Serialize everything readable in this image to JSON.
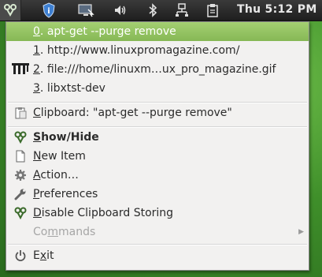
{
  "panel": {
    "clock": "Thu  5:12 PM",
    "icons": [
      "parcellite-icon",
      "security-shield-icon",
      "display-icon",
      "volume-icon",
      "bluetooth-icon",
      "network-icon",
      "clipboard-icon"
    ]
  },
  "menu": {
    "history": [
      {
        "num": "0",
        "text": ". apt-get --purge remove"
      },
      {
        "num": "1",
        "text": ". http://www.linuxpromagazine.com/"
      },
      {
        "num": "2",
        "text": ". file:///home/linuxm…ux_pro_magazine.gif"
      },
      {
        "num": "3",
        "text": ". libxtst-dev"
      }
    ],
    "clipboard": {
      "first": "C",
      "rest": "lipboard: \"apt-get --purge remove\""
    },
    "show_hide": {
      "first": "S",
      "rest": "how/Hide"
    },
    "new_item": {
      "first": "N",
      "rest": "ew Item"
    },
    "action": {
      "first": "A",
      "rest": "ction…"
    },
    "preferences": {
      "first": "P",
      "rest": "references"
    },
    "disable": {
      "first": "D",
      "rest": "isable Clipboard Storing"
    },
    "commands": {
      "pre": "Co",
      "u": "m",
      "rest": "mands"
    },
    "exit": {
      "first": "E",
      "u": "x",
      "rest": "it"
    }
  },
  "colors": {
    "highlight": "#94c462",
    "menu_bg": "#f2f1f0",
    "panel_bg": "#2a2a2a"
  }
}
